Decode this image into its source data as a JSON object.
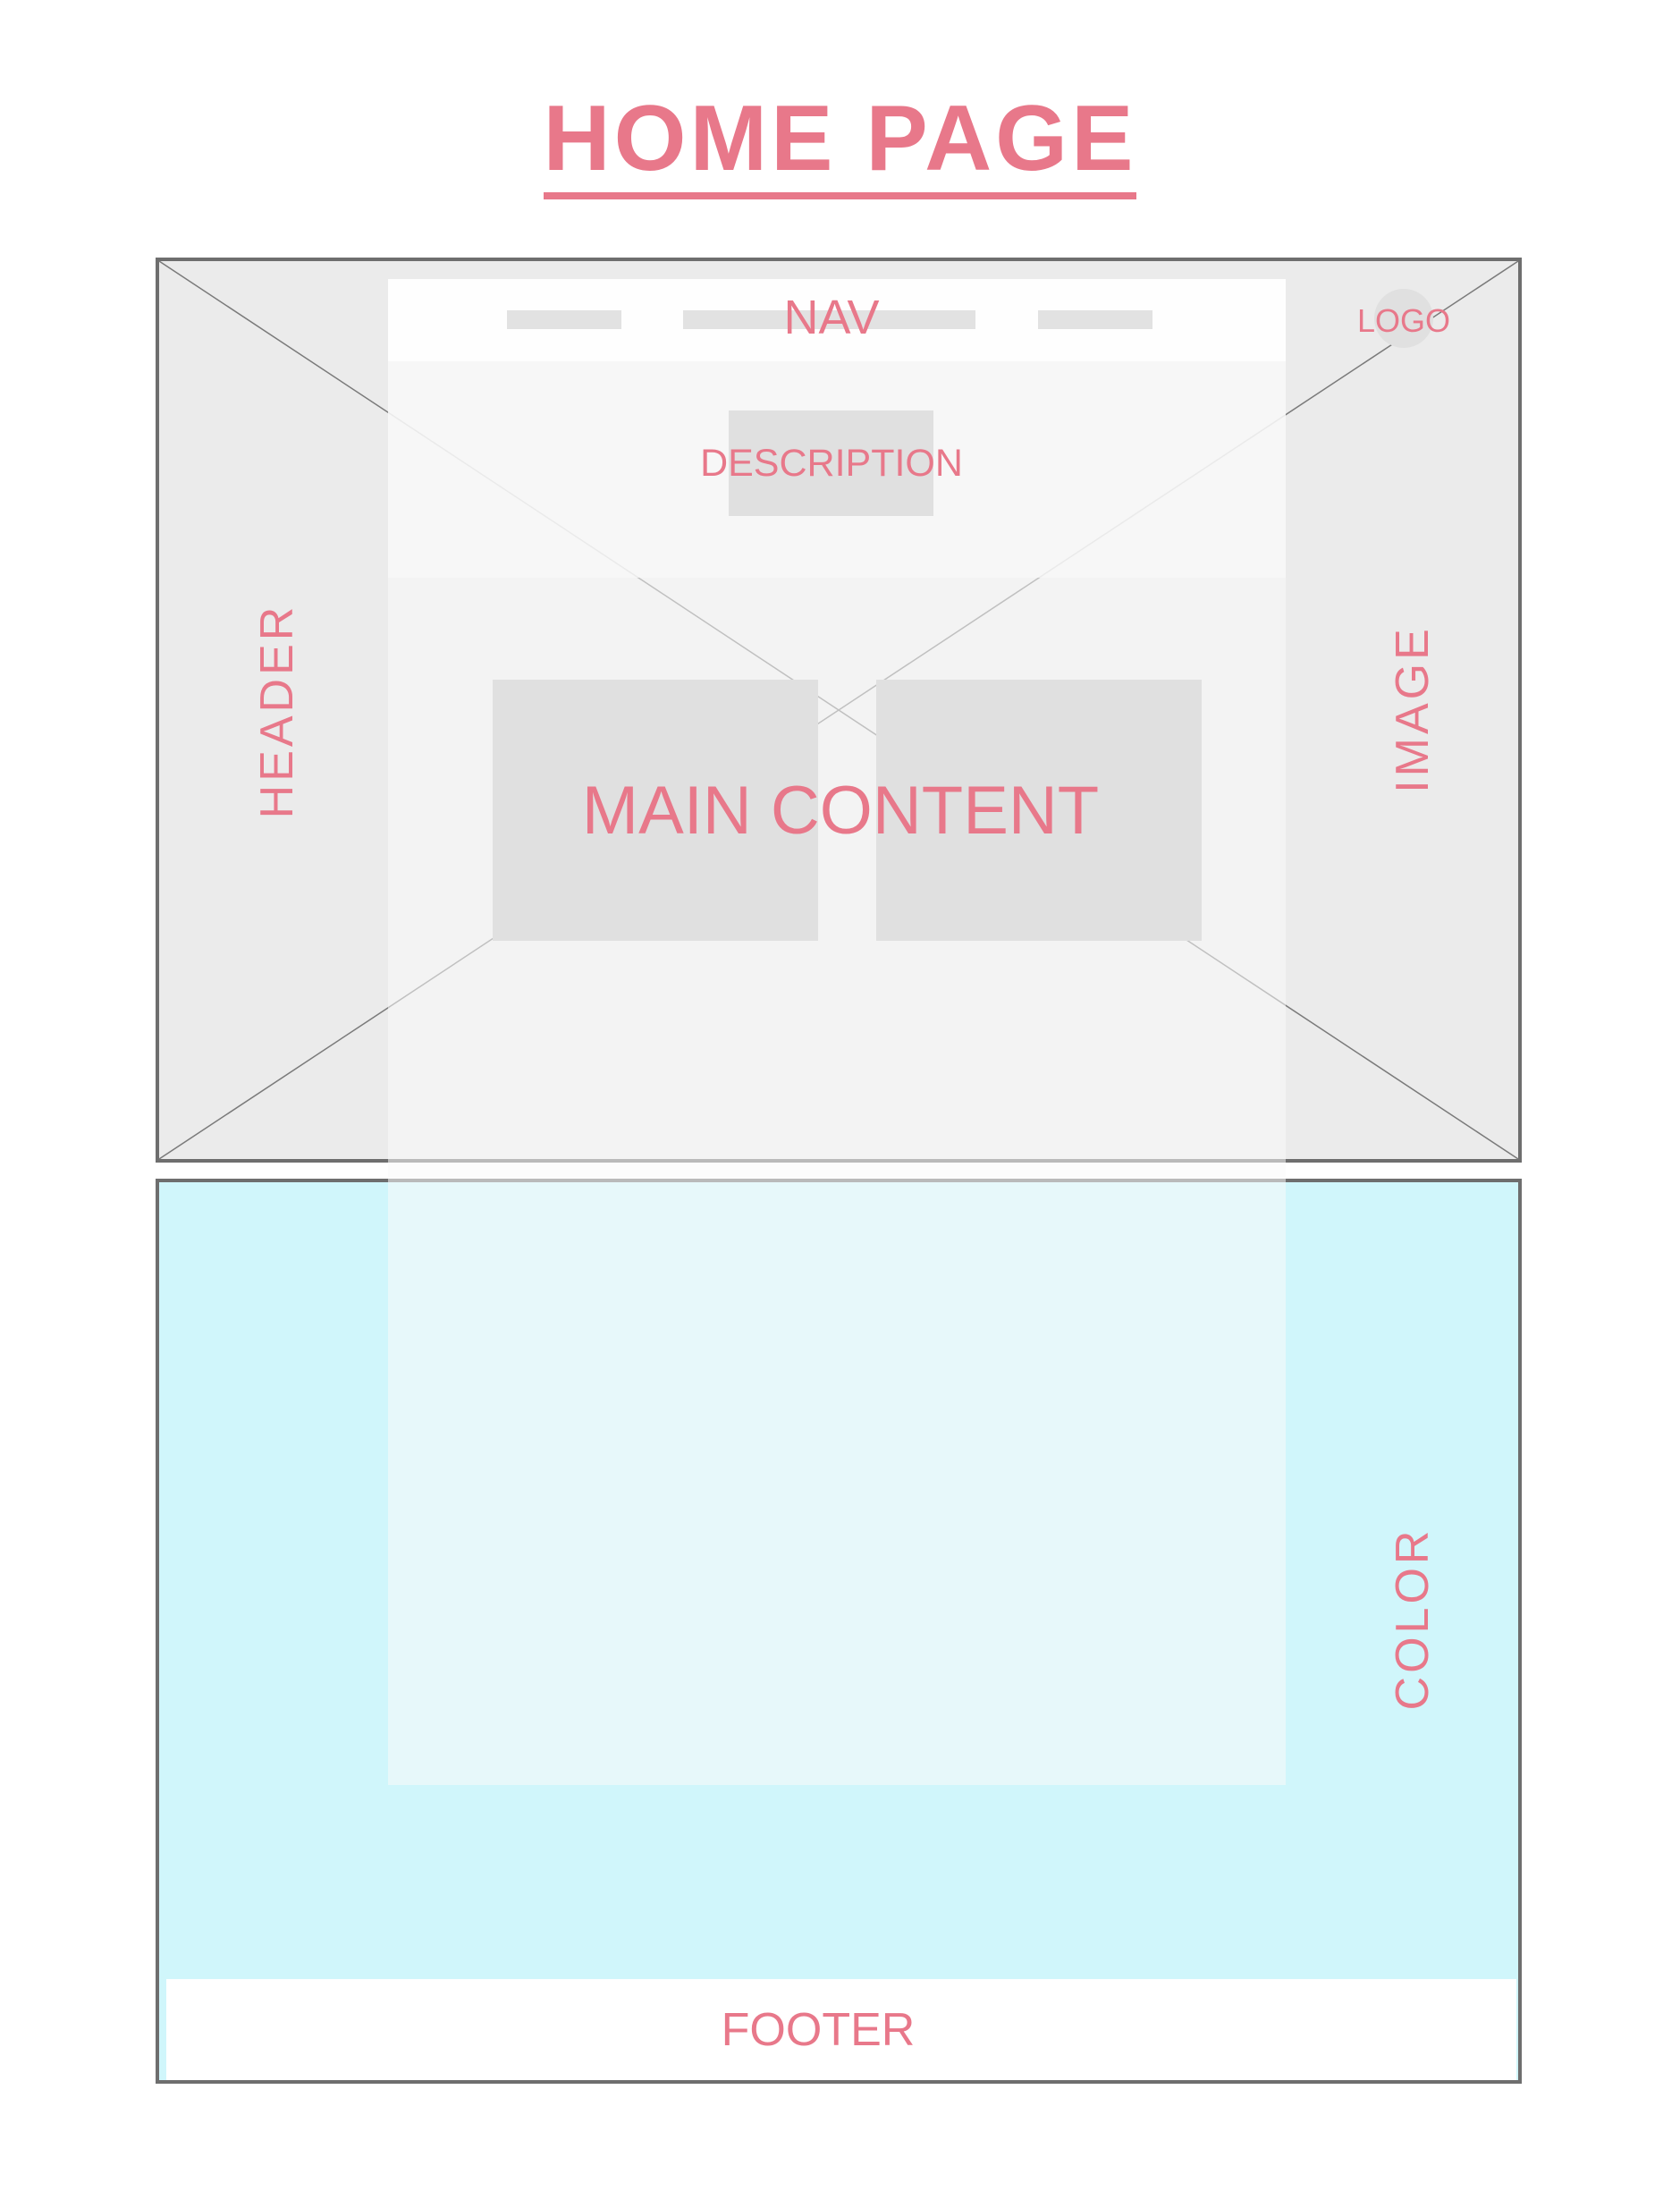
{
  "title": "HOME PAGE",
  "labels": {
    "nav": "NAV",
    "logo": "LOGO",
    "description": "DESCRIPTION",
    "main_content": "MAIN CONTENT",
    "header": "HEADER",
    "image": "IMAGE",
    "color": "COLOR",
    "footer": "FOOTER"
  },
  "colors": {
    "label_pink": "#e8788a",
    "frame_border": "#6e6e6e",
    "header_fill": "#ebebeb",
    "color_fill": "#d0f6fb",
    "placeholder_gray": "#e0e0e0"
  }
}
